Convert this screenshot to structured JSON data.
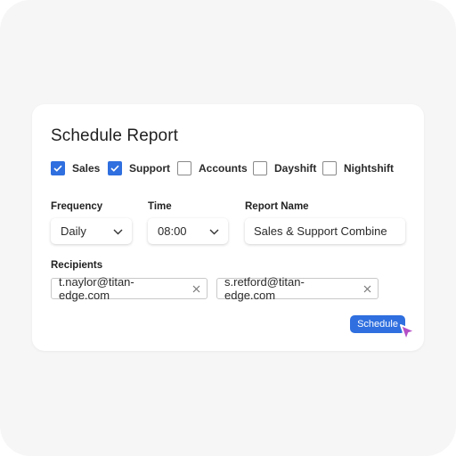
{
  "dialog": {
    "title": "Schedule Report",
    "teams": [
      {
        "label": "Sales",
        "checked": true
      },
      {
        "label": "Support",
        "checked": true
      },
      {
        "label": "Accounts",
        "checked": false
      },
      {
        "label": "Dayshift",
        "checked": false
      },
      {
        "label": "Nightshift",
        "checked": false
      }
    ],
    "frequency": {
      "label": "Frequency",
      "value": "Daily"
    },
    "time": {
      "label": "Time",
      "value": "08:00"
    },
    "report_name": {
      "label": "Report Name",
      "value": "Sales & Support Combine"
    },
    "recipients": {
      "label": "Recipients",
      "items": [
        "t.naylor@titan-edge.com",
        "s.retford@titan-edge.com"
      ]
    },
    "schedule_label": "Schedule"
  },
  "colors": {
    "accent": "#2f6fdf",
    "cursor": "#b44fc6"
  }
}
